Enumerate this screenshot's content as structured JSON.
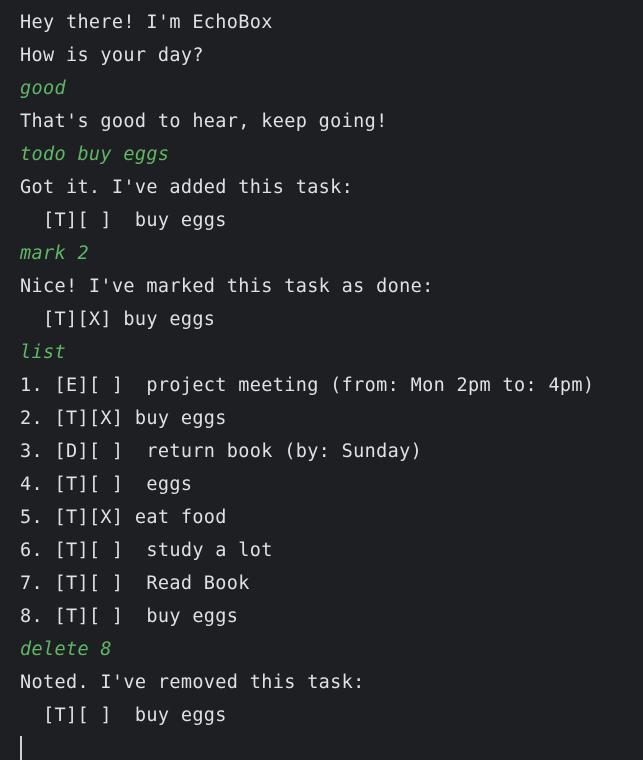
{
  "colors": {
    "background": "#1e1f22",
    "output_text": "#dfe1e5",
    "input_text": "#5fb865",
    "cursor": "#cfd1d4"
  },
  "transcript": [
    {
      "kind": "output",
      "text": "Hey there! I'm EchoBox"
    },
    {
      "kind": "output",
      "text": "How is your day?"
    },
    {
      "kind": "input",
      "text": "good"
    },
    {
      "kind": "output",
      "text": "That's good to hear, keep going!"
    },
    {
      "kind": "input",
      "text": "todo buy eggs"
    },
    {
      "kind": "output",
      "text": "Got it. I've added this task:"
    },
    {
      "kind": "output",
      "text": "  [T][ ]  buy eggs"
    },
    {
      "kind": "input",
      "text": "mark 2"
    },
    {
      "kind": "output",
      "text": "Nice! I've marked this task as done:"
    },
    {
      "kind": "output",
      "text": "  [T][X] buy eggs"
    },
    {
      "kind": "input",
      "text": "list"
    },
    {
      "kind": "output",
      "text": "1. [E][ ]  project meeting (from: Mon 2pm to: 4pm)"
    },
    {
      "kind": "output",
      "text": "2. [T][X] buy eggs"
    },
    {
      "kind": "output",
      "text": "3. [D][ ]  return book (by: Sunday)"
    },
    {
      "kind": "output",
      "text": "4. [T][ ]  eggs"
    },
    {
      "kind": "output",
      "text": "5. [T][X] eat food"
    },
    {
      "kind": "output",
      "text": "6. [T][ ]  study a lot"
    },
    {
      "kind": "output",
      "text": "7. [T][ ]  Read Book"
    },
    {
      "kind": "output",
      "text": "8. [T][ ]  buy eggs"
    },
    {
      "kind": "input",
      "text": "delete 8"
    },
    {
      "kind": "output",
      "text": "Noted. I've removed this task:"
    },
    {
      "kind": "output",
      "text": "  [T][ ]  buy eggs"
    }
  ]
}
